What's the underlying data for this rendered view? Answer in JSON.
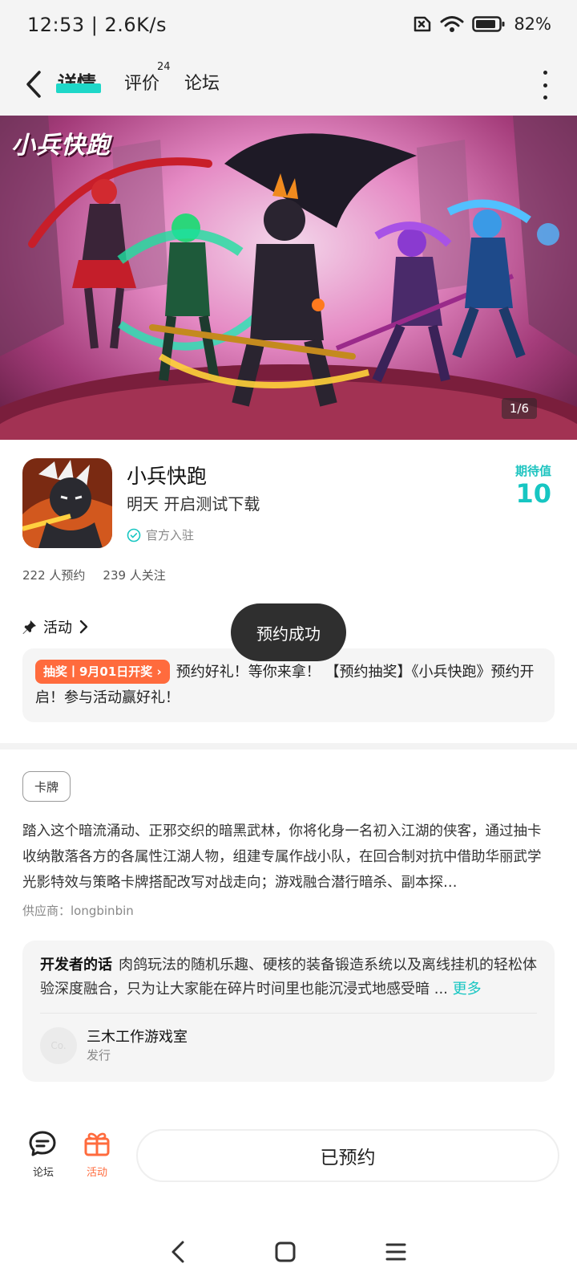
{
  "status": {
    "time": "12:53 | 2.6K/s",
    "battery": "82%"
  },
  "header": {
    "tabs": [
      {
        "label": "详情",
        "active": true
      },
      {
        "label": "评价",
        "badge": "24"
      },
      {
        "label": "论坛"
      }
    ]
  },
  "banner": {
    "logo_text": "小兵快跑",
    "counter": "1/6"
  },
  "app": {
    "name": "小兵快跑",
    "subtitle": "明天 开启测试下载",
    "official": "官方入驻",
    "expect_label": "期待值",
    "expect_value": "10",
    "reservations": "222 人预约",
    "followers": "239 人关注"
  },
  "activity": {
    "title": "活动",
    "tag": "抽奖丨9月01日开奖",
    "text": "预约好礼！等你来拿！ 【预约抽奖】《小兵快跑》预约开启！参与活动赢好礼！"
  },
  "toast": "预约成功",
  "description": {
    "genre": "卡牌",
    "text": "踏入这个暗流涌动、正邪交织的暗黑武林，你将化身一名初入江湖的侠客，通过抽卡收纳散落各方的各属性江湖人物，组建专属作战小队，在回合制对抗中借助华丽武学光影特效与策略卡牌搭配改写对战走向；游戏融合潜行暗杀、副本探…",
    "supplier": "供应商：longbinbin"
  },
  "developer": {
    "heading": "开发者的话",
    "text": "肉鸽玩法的随机乐趣、硬核的装备锻造系统以及离线挂机的轻松体验深度融合，只为让大家能在碎片时间里也能沉浸式地感受暗 ...",
    "more": "更多",
    "avatar_text": "Co.",
    "name": "三木工作游戏室",
    "role": "发行"
  },
  "bottom": {
    "forum_label": "论坛",
    "activity_label": "活动",
    "reserved_button": "已预约"
  },
  "colors": {
    "accent": "#17c6c2",
    "orange": "#ff6b3d"
  }
}
